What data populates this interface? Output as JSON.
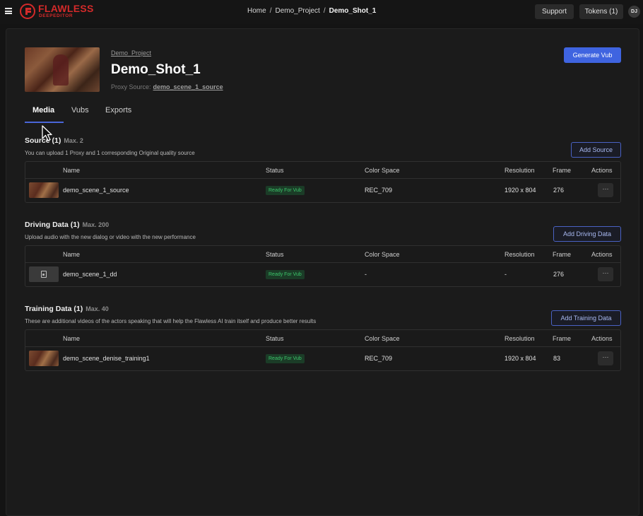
{
  "topbar": {
    "logo_title": "FLAWLESS",
    "logo_subtitle": "DEEPEDITOR",
    "breadcrumb": [
      "Home",
      "Demo_Project",
      "Demo_Shot_1"
    ],
    "support_label": "Support",
    "tokens_label": "Tokens (1)",
    "avatar_initials": "DJ"
  },
  "shot": {
    "project_link": "Demo_Project",
    "title": "Demo_Shot_1",
    "proxy_label": "Proxy Source:",
    "proxy_value": "demo_scene_1_source",
    "generate_label": "Generate Vub"
  },
  "tabs": [
    "Media",
    "Vubs",
    "Exports"
  ],
  "columns": {
    "name": "Name",
    "status": "Status",
    "color_space": "Color Space",
    "resolution": "Resolution",
    "frames": "Frame",
    "actions": "Actions"
  },
  "sections": [
    {
      "title": "Source (1)",
      "max": "Max. 2",
      "description": "You can upload 1 Proxy and 1 corresponding Original quality source",
      "add_label": "Add Source",
      "rows": [
        {
          "name": "demo_scene_1_source",
          "status": "Ready For Vub",
          "color_space": "REC_709",
          "resolution": "1920 x 804",
          "frames": "276",
          "actions": "···"
        }
      ]
    },
    {
      "title": "Driving Data (1)",
      "max": "Max. 200",
      "description": "Upload audio with the new dialog or video with the new performance",
      "add_label": "Add Driving Data",
      "rows": [
        {
          "name": "demo_scene_1_dd",
          "status": "Ready For Vub",
          "color_space": "-",
          "resolution": "-",
          "frames": "276",
          "actions": "···"
        }
      ]
    },
    {
      "title": "Training Data (1)",
      "max": "Max. 40",
      "description": "These are additional videos of the actors speaking that will help the Flawless AI train itself and produce better results",
      "add_label": "Add Training Data",
      "rows": [
        {
          "name": "demo_scene_denise_training1",
          "status": "Ready For Vub",
          "color_space": "REC_709",
          "resolution": "1920 x 804",
          "frames": "83",
          "actions": "···"
        }
      ]
    }
  ],
  "colors": {
    "accent": "#3f64e0",
    "brand": "#d42a2a",
    "ready_badge": "#3cc46a"
  }
}
